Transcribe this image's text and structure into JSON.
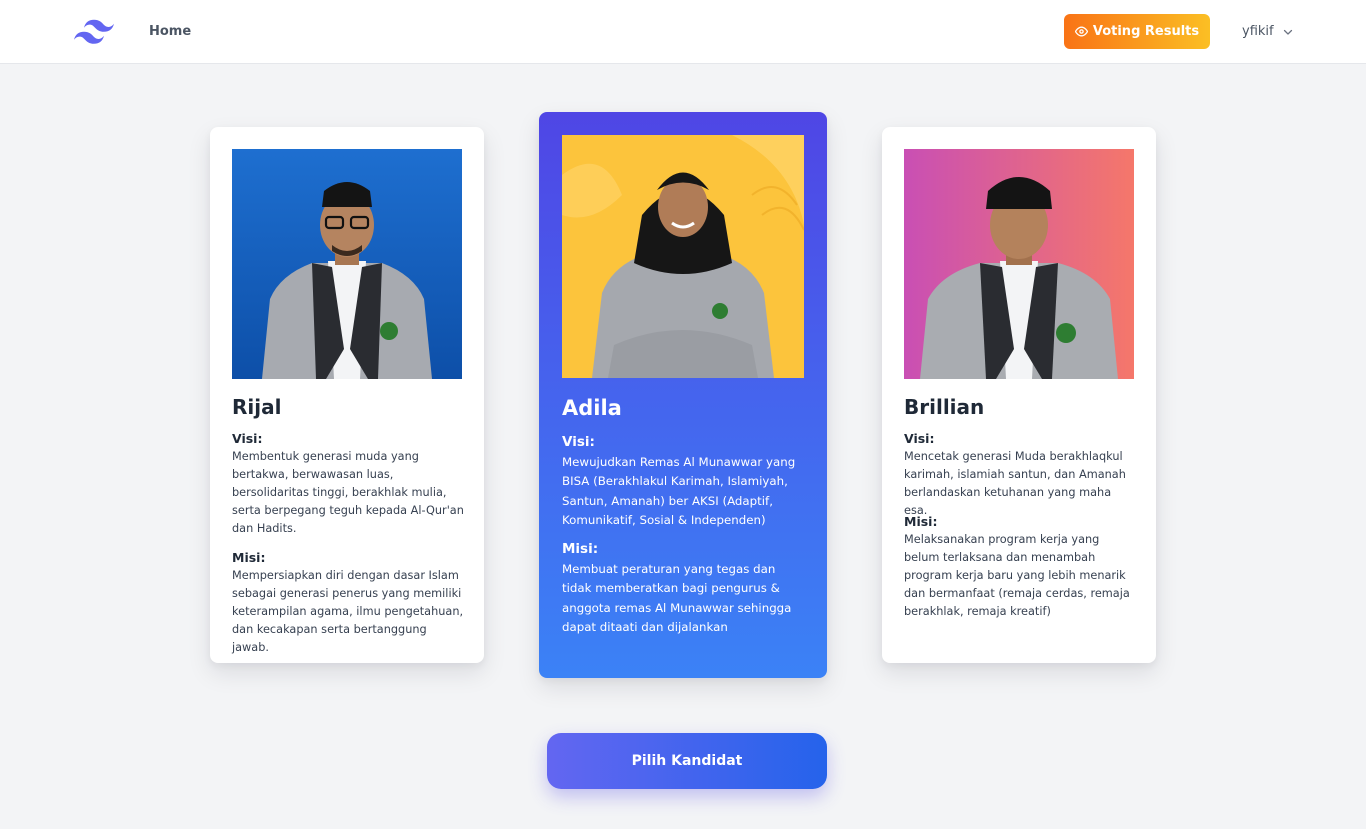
{
  "nav": {
    "home_label": "Home",
    "results_label": "Voting Results",
    "username": "yfikif"
  },
  "candidates": [
    {
      "name": "Rijal",
      "visi_label": "Visi:",
      "visi": "Membentuk generasi muda yang bertakwa, berwawasan luas, bersolidaritas tinggi, berakhlak mulia, serta berpegang teguh kepada Al-Qur'an dan Hadits.",
      "misi_label": "Misi:",
      "misi": "Mempersiapkan diri dengan dasar Islam sebagai generasi penerus yang memiliki keterampilan agama, ilmu pengetahuan, dan kecakapan serta bertanggung jawab.",
      "photo_bg": "#1565c0"
    },
    {
      "name": "Adila",
      "visi_label": "Visi:",
      "visi": "Mewujudkan Remas Al Munawwar yang BISA (Berakhlakul Karimah, Islamiyah, Santun, Amanah) ber AKSI (Adaptif, Komunikatif, Sosial & Independen)",
      "misi_label": "Misi:",
      "misi": "Membuat peraturan yang tegas dan tidak memberatkan bagi pengurus & anggota remas Al Munawwar sehingga dapat ditaati dan dijalankan",
      "photo_bg": "#fcc43c"
    },
    {
      "name": "Brillian",
      "visi_label": "Visi:",
      "visi": "Mencetak generasi Muda berakhlaqkul karimah, islamiah santun, dan Amanah berlandaskan ketuhanan yang maha esa.",
      "misi_label": "Misi:",
      "misi": "Melaksanakan program kerja yang belum terlaksana dan menambah program kerja baru yang lebih menarik dan bermanfaat (remaja cerdas, remaja berakhlak, remaja kreatif)",
      "photo_bg": "#e0609a"
    }
  ],
  "choose_label": "Pilih Kandidat",
  "colors": {
    "accent": "#4f46e5",
    "results_gradient": [
      "#f97316",
      "#fbbf24"
    ],
    "featured_gradient": [
      "#4f46e5",
      "#3b82f6"
    ]
  },
  "icons": {
    "logo": "tailwind-wave-logo",
    "results": "eye-icon",
    "user_menu": "chevron-down-icon"
  }
}
